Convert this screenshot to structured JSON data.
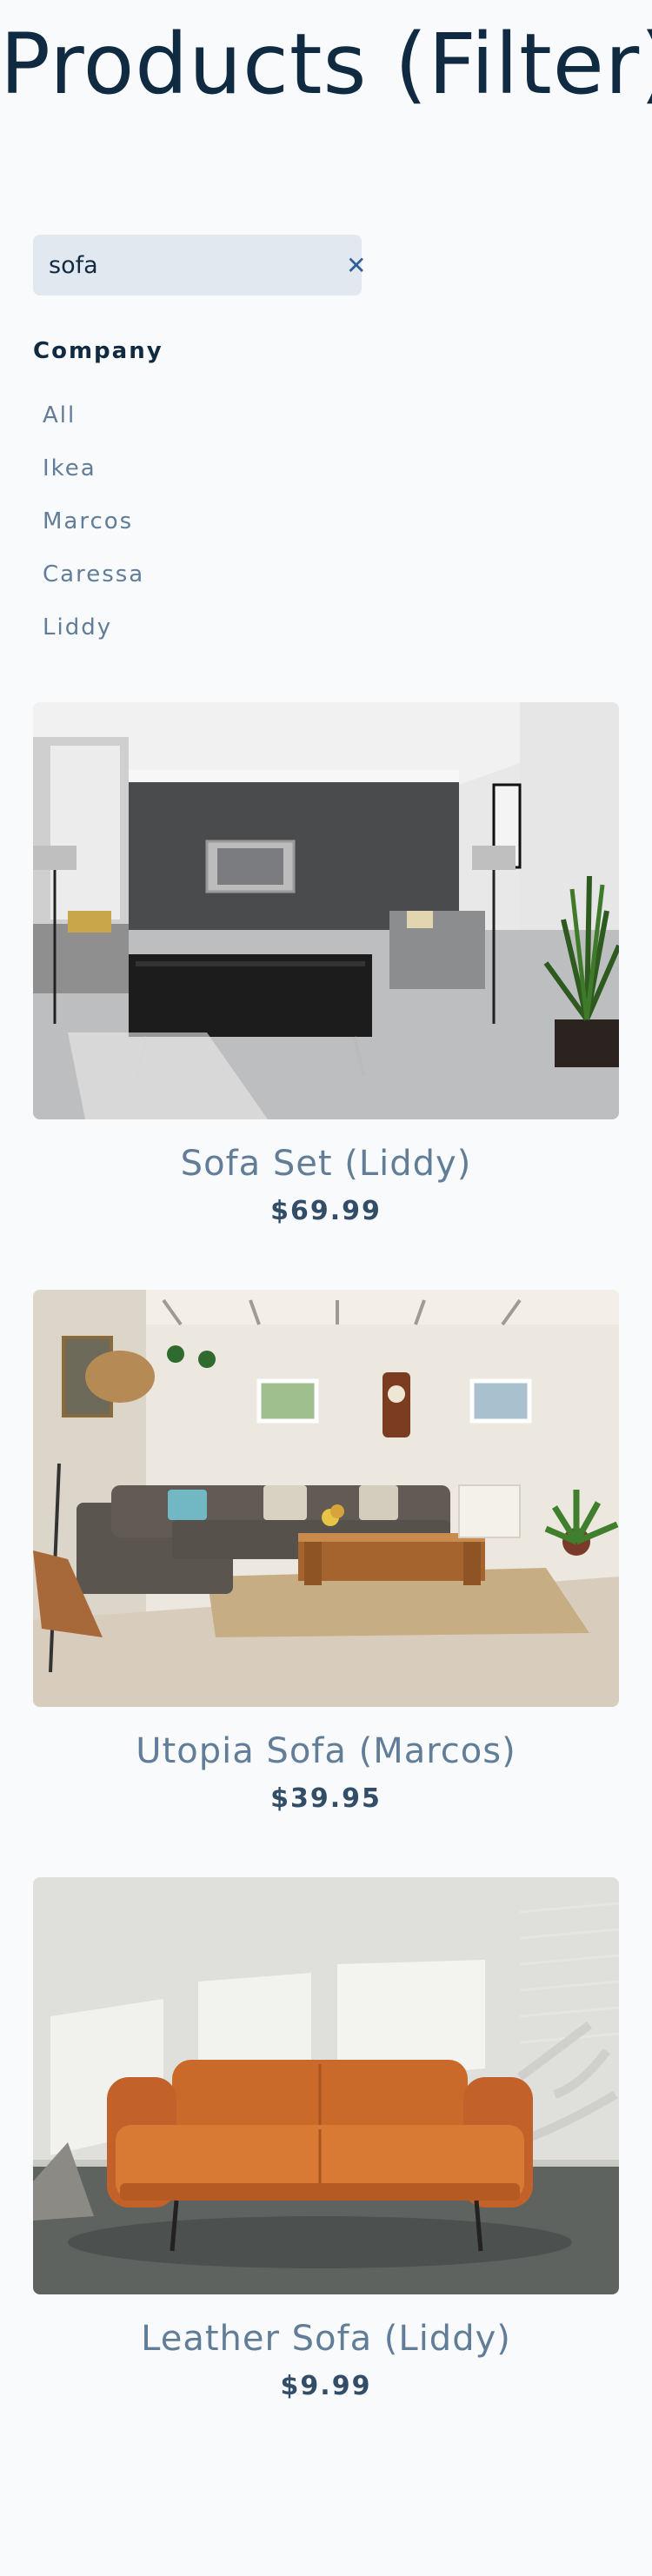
{
  "header": {
    "title": "Products (Filter)"
  },
  "search": {
    "value": "sofa",
    "clear_icon": "close-icon",
    "clear_glyph": "✕"
  },
  "filters": {
    "heading": "Company",
    "companies": [
      "All",
      "Ikea",
      "Marcos",
      "Caressa",
      "Liddy"
    ]
  },
  "products": [
    {
      "name": "Sofa Set (Liddy)",
      "price": "$69.99"
    },
    {
      "name": "Utopia Sofa (Marcos)",
      "price": "$39.95"
    },
    {
      "name": "Leather Sofa (Liddy)",
      "price": "$9.99"
    }
  ],
  "colors": {
    "accent": "#2f5e9a",
    "input_bg": "#e2e8f0",
    "muted_text": "#617d98",
    "page_bg": "#f8fafc"
  }
}
